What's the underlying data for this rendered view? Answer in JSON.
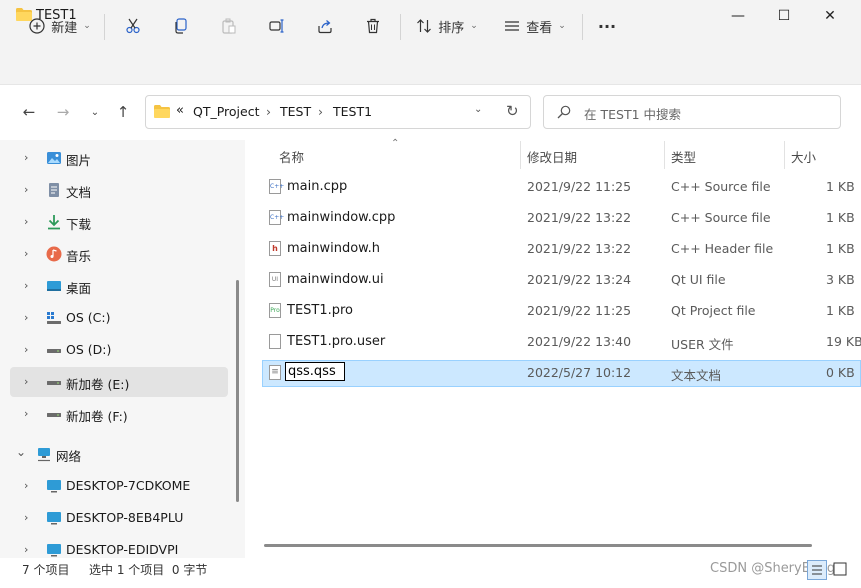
{
  "window": {
    "title": "TEST1",
    "minimize": "—",
    "maximize": "☐",
    "close": "✕"
  },
  "toolbar": {
    "new_label": "新建",
    "sort_label": "排序",
    "view_label": "查看",
    "more": "···"
  },
  "address": {
    "overflow": "«",
    "crumbs": [
      "QT_Project",
      "TEST",
      "TEST1"
    ],
    "separator": "›",
    "search_placeholder": "在 TEST1 中搜索"
  },
  "sidebar": {
    "items": [
      {
        "label": "图片",
        "icon": "pictures-icon"
      },
      {
        "label": "文档",
        "icon": "documents-icon"
      },
      {
        "label": "下载",
        "icon": "downloads-icon"
      },
      {
        "label": "音乐",
        "icon": "music-icon"
      },
      {
        "label": "桌面",
        "icon": "desktop-icon"
      },
      {
        "label": "OS (C:)",
        "icon": "drive-icon"
      },
      {
        "label": "OS (D:)",
        "icon": "drive-icon"
      },
      {
        "label": "新加卷 (E:)",
        "icon": "drive-icon"
      },
      {
        "label": "新加卷 (F:)",
        "icon": "drive-icon"
      },
      {
        "label": "网络",
        "icon": "network-icon"
      },
      {
        "label": "DESKTOP-7CDKOME",
        "icon": "computer-icon"
      },
      {
        "label": "DESKTOP-8EB4PLU",
        "icon": "computer-icon"
      },
      {
        "label": "DESKTOP-EDIDVPI",
        "icon": "computer-icon"
      }
    ]
  },
  "columns": {
    "name": "名称",
    "date": "修改日期",
    "type": "类型",
    "size": "大小"
  },
  "files": [
    {
      "name": "main.cpp",
      "date": "2021/9/22 11:25",
      "type": "C++ Source file",
      "size": "1 KB",
      "icon": "cpp-file-icon"
    },
    {
      "name": "mainwindow.cpp",
      "date": "2021/9/22 13:22",
      "type": "C++ Source file",
      "size": "1 KB",
      "icon": "cpp-file-icon"
    },
    {
      "name": "mainwindow.h",
      "date": "2021/9/22 13:22",
      "type": "C++ Header file",
      "size": "1 KB",
      "icon": "header-file-icon"
    },
    {
      "name": "mainwindow.ui",
      "date": "2021/9/22 13:24",
      "type": "Qt UI file",
      "size": "3 KB",
      "icon": "ui-file-icon"
    },
    {
      "name": "TEST1.pro",
      "date": "2021/9/22 11:25",
      "type": "Qt Project file",
      "size": "1 KB",
      "icon": "pro-file-icon"
    },
    {
      "name": "TEST1.pro.user",
      "date": "2021/9/22 13:40",
      "type": "USER 文件",
      "size": "19 KB",
      "icon": "blank-file-icon"
    },
    {
      "name": "qss.qss",
      "date": "2022/5/27 10:12",
      "type": "文本文档",
      "size": "0 KB",
      "icon": "text-file-icon"
    }
  ],
  "status": {
    "item_count": "7 个项目",
    "selection": "选中 1 个项目  0 字节"
  },
  "watermark": "CSDN @SheryBang"
}
